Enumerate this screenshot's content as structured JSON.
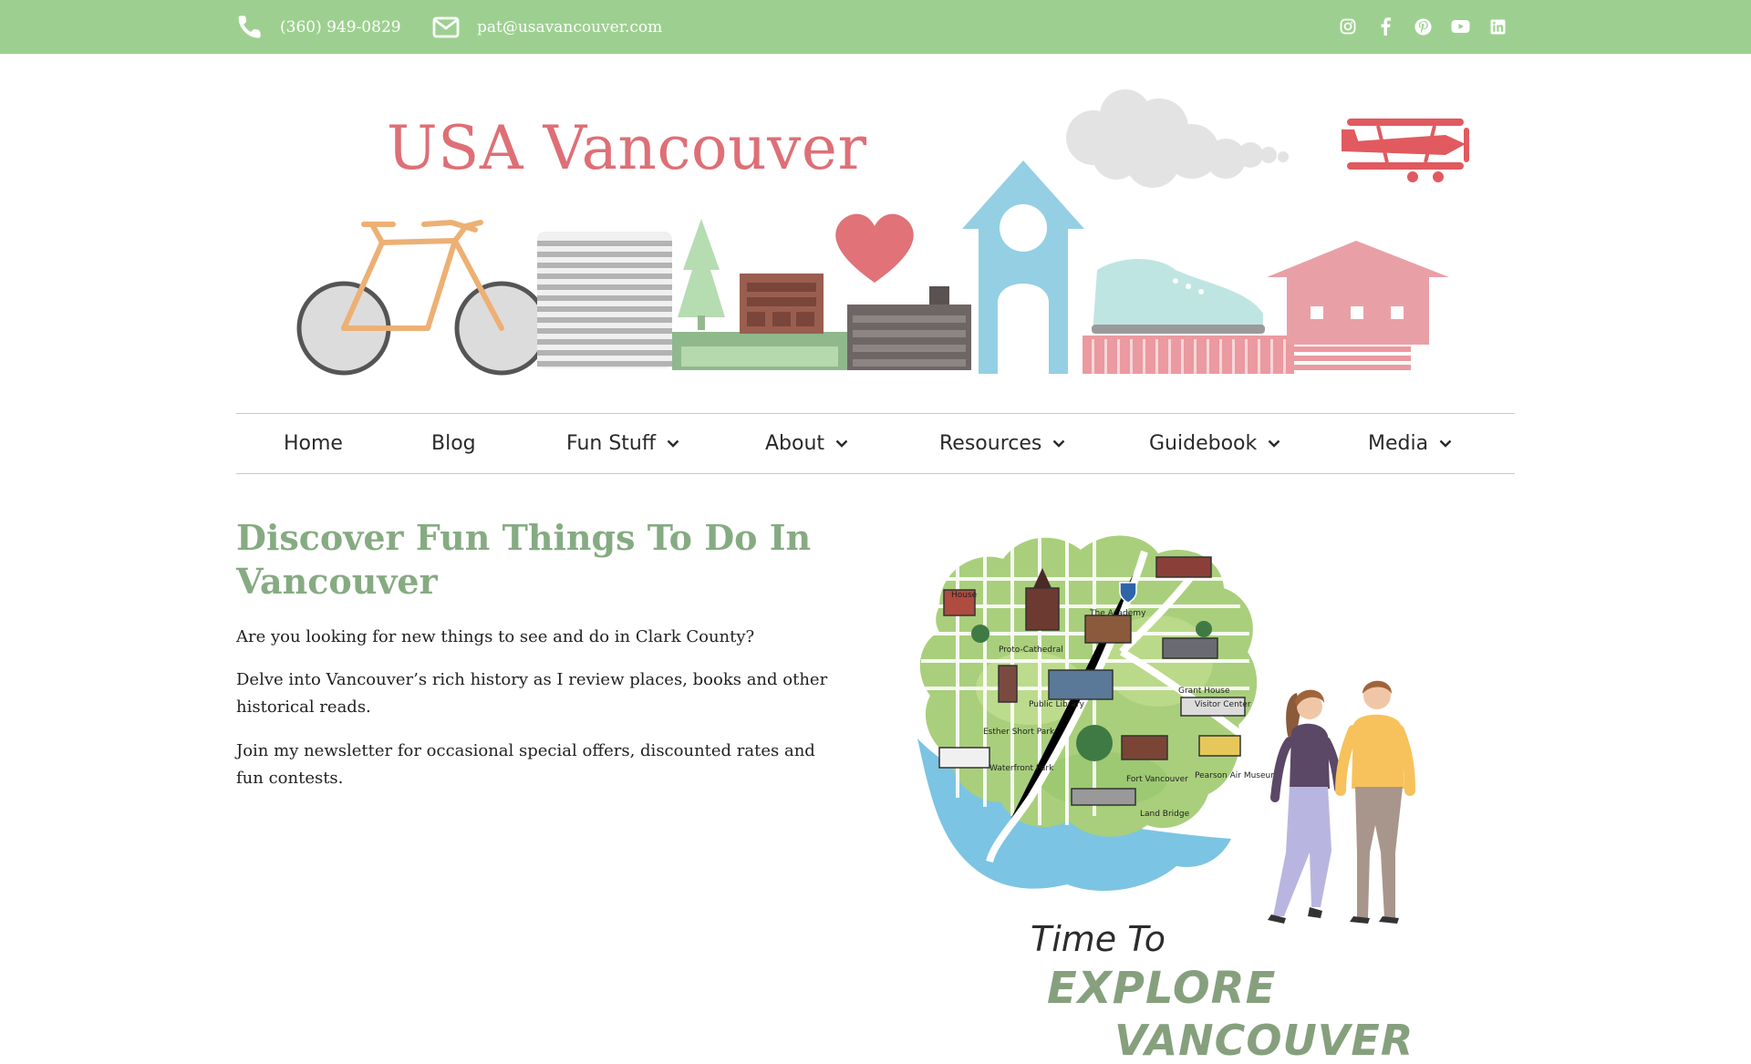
{
  "topbar": {
    "phone": "(360) 949-0829",
    "email": "pat@usavancouver.com",
    "bg_color": "#9dd090",
    "social": [
      "instagram-icon",
      "facebook-icon",
      "pinterest-icon",
      "youtube-icon",
      "linkedin-icon"
    ]
  },
  "header": {
    "title": "USA Vancouver",
    "title_color": "#de6f76"
  },
  "nav": {
    "items": [
      {
        "label": "Home",
        "has_dropdown": false
      },
      {
        "label": "Blog",
        "has_dropdown": false
      },
      {
        "label": "Fun Stuff",
        "has_dropdown": true
      },
      {
        "label": "About",
        "has_dropdown": true
      },
      {
        "label": "Resources",
        "has_dropdown": true
      },
      {
        "label": "Guidebook",
        "has_dropdown": true
      },
      {
        "label": "Media",
        "has_dropdown": true
      }
    ]
  },
  "main": {
    "heading": "Discover Fun Things To Do In Vancouver",
    "paragraphs": [
      "Are you looking for new things to see and do in Clark County?",
      "Delve into Vancouver’s rich history as I review places, books and other historical reads.",
      "Join my newsletter for occasional special offers, discounted rates and fun contests."
    ],
    "heading_color": "#86ab82"
  },
  "illustration": {
    "map_labels": [
      "House",
      "Proto-Cathedral",
      "The Academy",
      "Public Library",
      "Esther Short Park",
      "Grant House",
      "Visitor Center",
      "Waterfront Park",
      "Fort Vancouver",
      "Pearson Air Museum",
      "Land Bridge"
    ],
    "line1": "Time To",
    "line2": "EXPLORE",
    "line3": "VANCOUVER"
  }
}
